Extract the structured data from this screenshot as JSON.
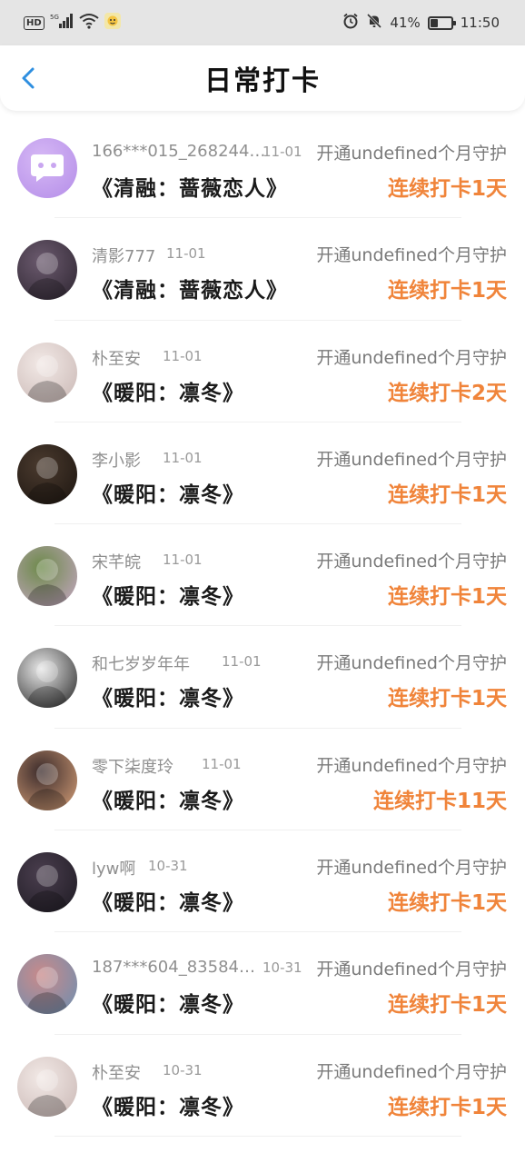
{
  "status_bar": {
    "hd": "HD",
    "network": "5G",
    "battery_percent": "41%",
    "battery_level": 0.41,
    "time": "11:50"
  },
  "header": {
    "title": "日常打卡"
  },
  "items": [
    {
      "name": "166***015_268244…",
      "date": "11-01",
      "guard": "开通undefined个月守护",
      "book": "《清融：蔷薇恋人》",
      "streak": "连续打卡1天",
      "avatar_colors": [
        "#d6b8f5",
        "#b48de8"
      ],
      "avatar_icon": "chat-bubble-icon"
    },
    {
      "name": "清影777",
      "date": "11-01",
      "guard": "开通undefined个月守护",
      "book": "《清融：蔷薇恋人》",
      "streak": "连续打卡1天",
      "avatar_colors": [
        "#6b5a6e",
        "#2d2530"
      ]
    },
    {
      "name": "朴至安",
      "date": "11-01",
      "guard": "开通undefined个月守护",
      "book": "《暖阳：凛冬》",
      "streak": "连续打卡2天",
      "avatar_colors": [
        "#f2e9e6",
        "#c9b7b4"
      ]
    },
    {
      "name": "李小影",
      "date": "11-01",
      "guard": "开通undefined个月守护",
      "book": "《暖阳：凛冬》",
      "streak": "连续打卡1天",
      "avatar_colors": [
        "#4a3a2e",
        "#1c1510"
      ]
    },
    {
      "name": "宋芊皖",
      "date": "11-01",
      "guard": "开通undefined个月守护",
      "book": "《暖阳：凛冬》",
      "streak": "连续打卡1天",
      "avatar_colors": [
        "#6d8a4a",
        "#c7a7c6"
      ]
    },
    {
      "name": "和七岁岁年年",
      "date": "11-01",
      "guard": "开通undefined个月守护",
      "book": "《暖阳：凛冬》",
      "streak": "连续打卡1天",
      "avatar_colors": [
        "#e8e8e8",
        "#222222"
      ]
    },
    {
      "name": "零下柒度玲",
      "date": "11-01",
      "guard": "开通undefined个月守护",
      "book": "《暖阳：凛冬》",
      "streak": "连续打卡11天",
      "avatar_colors": [
        "#3b2b2b",
        "#d9a27a"
      ]
    },
    {
      "name": "lyw啊",
      "date": "10-31",
      "guard": "开通undefined个月守护",
      "book": "《暖阳：凛冬》",
      "streak": "连续打卡1天",
      "avatar_colors": [
        "#4a3e4e",
        "#1d1a22"
      ]
    },
    {
      "name": "187***604_83584…",
      "date": "10-31",
      "guard": "开通undefined个月守护",
      "book": "《暖阳：凛冬》",
      "streak": "连续打卡1天",
      "avatar_colors": [
        "#c98a8a",
        "#6a8fb2"
      ]
    },
    {
      "name": "朴至安",
      "date": "10-31",
      "guard": "开通undefined个月守护",
      "book": "《暖阳：凛冬》",
      "streak": "连续打卡1天",
      "avatar_colors": [
        "#f2e9e6",
        "#c9b7b4"
      ]
    }
  ],
  "colors": {
    "accent": "#f0843a",
    "back_icon": "#2f8fe0",
    "status_bar_bg": "#e5e5e5"
  }
}
